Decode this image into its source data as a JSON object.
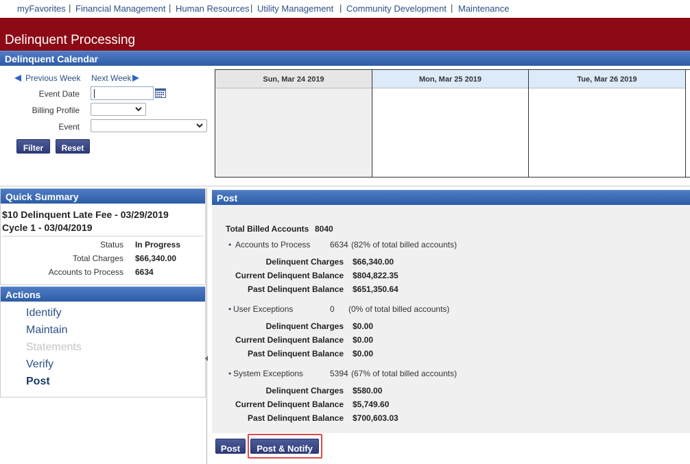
{
  "nav": {
    "items": [
      "myFavorites",
      "Financial Management",
      "Human Resources",
      "Utility Management",
      "Community Development",
      "Maintenance"
    ],
    "separator": "|"
  },
  "page": {
    "title": "Delinquent Processing"
  },
  "calendar_section": {
    "title": "Delinquent Calendar"
  },
  "filter": {
    "prev_week": "Previous Week",
    "next_week": "Next Week",
    "event_date_label": "Event Date",
    "event_date_value": "",
    "billing_profile_label": "Billing Profile",
    "billing_profile_value": "",
    "event_label": "Event",
    "event_value": "",
    "filter_button": "Filter",
    "reset_button": "Reset"
  },
  "calendar": {
    "days": [
      "Sun, Mar 24 2019",
      "Mon, Mar 25 2019",
      "Tue, Mar 26 2019"
    ]
  },
  "quick_summary": {
    "title": "Quick Summary",
    "event_name": "$10 Delinquent Late Fee - 03/29/2019",
    "cycle": "Cycle 1 - 03/04/2019",
    "status_label": "Status",
    "status_value": "In Progress",
    "total_charges_label": "Total Charges",
    "total_charges_value": "$66,340.00",
    "accounts_label": "Accounts to Process",
    "accounts_value": "6634"
  },
  "actions": {
    "title": "Actions",
    "items": [
      {
        "label": "Identify",
        "state": "enabled"
      },
      {
        "label": "Maintain",
        "state": "enabled"
      },
      {
        "label": "Statements",
        "state": "disabled"
      },
      {
        "label": "Verify",
        "state": "enabled"
      },
      {
        "label": "Post",
        "state": "current"
      }
    ]
  },
  "post": {
    "title": "Post",
    "total_billed_label": "Total Billed Accounts",
    "total_billed_value": "8040",
    "groups": [
      {
        "label": "Accounts to Process",
        "count": "6634",
        "pct": "(82% of total billed accounts)",
        "rows": [
          {
            "label": "Delinquent Charges",
            "value": "$66,340.00"
          },
          {
            "label": "Current Delinquent Balance",
            "value": "$804,822.35"
          },
          {
            "label": "Past Delinquent Balance",
            "value": "$651,350.64"
          }
        ]
      },
      {
        "label": "User Exceptions",
        "count": "0",
        "pct": "(0% of total billed accounts)",
        "rows": [
          {
            "label": "Delinquent Charges",
            "value": "$0.00"
          },
          {
            "label": "Current Delinquent Balance",
            "value": "$0.00"
          },
          {
            "label": "Past Delinquent Balance",
            "value": "$0.00"
          }
        ]
      },
      {
        "label": "System Exceptions",
        "count": "5394",
        "pct": "(67% of total billed accounts)",
        "rows": [
          {
            "label": "Delinquent Charges",
            "value": "$580.00"
          },
          {
            "label": "Current Delinquent Balance",
            "value": "$5,749.60"
          },
          {
            "label": "Past Delinquent Balance",
            "value": "$700,603.03"
          }
        ]
      }
    ],
    "post_button": "Post",
    "post_notify_button": "Post & Notify"
  },
  "colors": {
    "banner": "#8c0a15",
    "header_bar": "#3a67b0",
    "button": "#3a4a88",
    "link": "#2c4f86",
    "highlight_border": "#e04848"
  }
}
